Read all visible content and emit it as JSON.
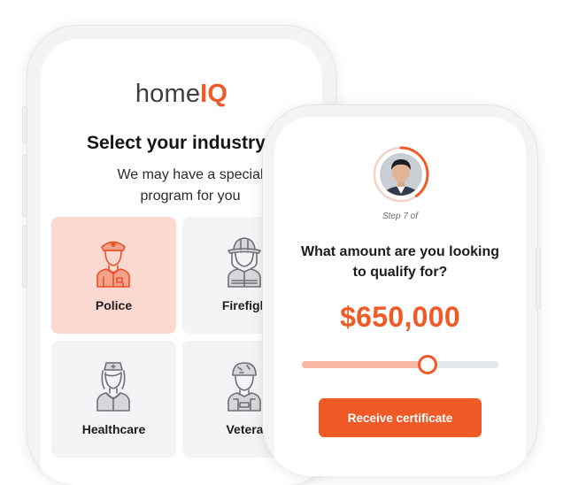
{
  "brand": {
    "logo_home": "home",
    "logo_iq": "IQ",
    "accent": "#ef5a26"
  },
  "industry_screen": {
    "title": "Select your industry",
    "subtitle": "We may have a special program for you",
    "tiles": [
      {
        "label": "Police",
        "icon": "police-officer-icon",
        "selected": true
      },
      {
        "label": "Firefigh",
        "icon": "firefighter-icon",
        "selected": false
      },
      {
        "label": "Healthcare",
        "icon": "nurse-icon",
        "selected": false
      },
      {
        "label": "Vetera",
        "icon": "soldier-icon",
        "selected": false
      }
    ]
  },
  "qualify_screen": {
    "step_text": "Step 7 of",
    "question": "What amount are you looking to qualify for?",
    "amount": "$650,000",
    "slider_level": 0.64,
    "button_label": "Receive certificate",
    "avatar": "advisor-avatar",
    "progress_ring": 0.4
  }
}
